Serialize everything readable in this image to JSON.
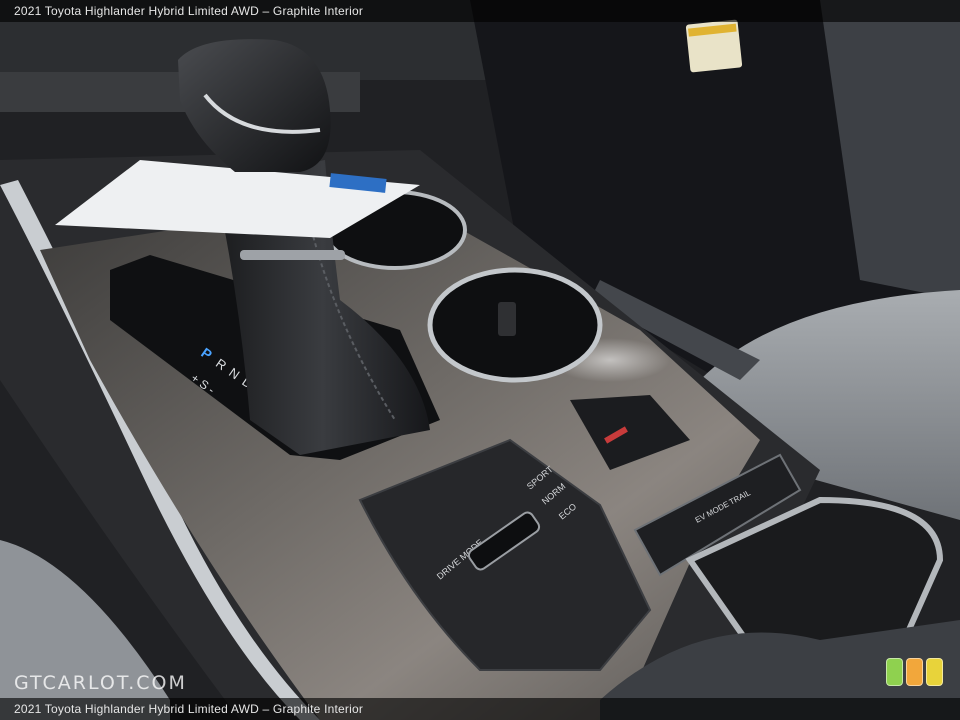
{
  "caption": {
    "top": "2021 Toyota Highlander Hybrid Limited AWD – Graphite Interior",
    "bottom": "2021 Toyota Highlander Hybrid Limited AWD – Graphite Interior"
  },
  "watermark": "GTCARLOT.COM",
  "shifter": {
    "gears": [
      "P",
      "R",
      "N",
      "D",
      "+ S -"
    ]
  },
  "drive_mode": {
    "label": "DRIVE MODE",
    "modes": [
      "SPORT",
      "NORM",
      "ECO"
    ]
  },
  "buttons": {
    "ev_mode": "EV MODE",
    "trail": "TRAIL"
  },
  "rating": {
    "colors": [
      "#8fd14f",
      "#f2a73b",
      "#e8d33a"
    ]
  }
}
